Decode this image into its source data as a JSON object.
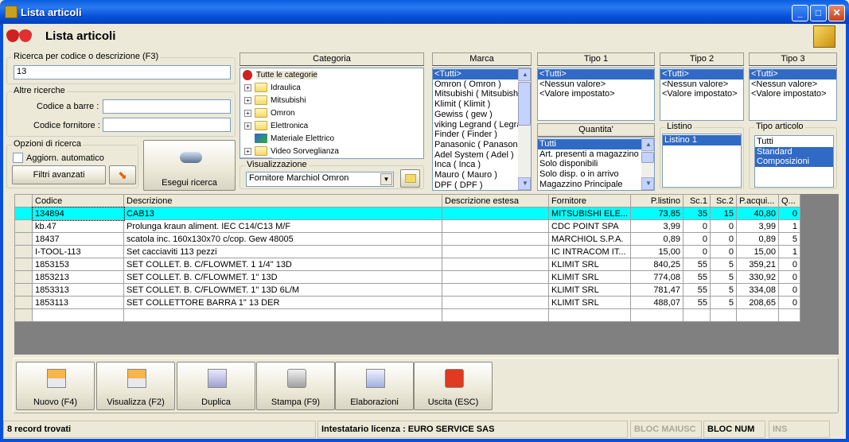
{
  "window": {
    "title": "Lista articoli"
  },
  "header": {
    "title": "Lista articoli"
  },
  "search": {
    "legend": "Ricerca per codice o descrizione (F3)",
    "value": "13"
  },
  "other": {
    "legend": "Altre ricerche",
    "barcode_label": "Codice a barre :",
    "barcode_value": "",
    "supplier_code_label": "Codice fornitore :",
    "supplier_code_value": ""
  },
  "options": {
    "legend": "Opzioni di ricerca",
    "auto_update_label": "Aggiorn. automatico",
    "auto_update_checked": false,
    "advanced_filters": "Filtri avanzati",
    "run_search": "Esegui ricerca"
  },
  "category": {
    "header": "Categoria",
    "items": [
      "Tutte le categorie",
      "Idraulica",
      "Mitsubishi",
      "Omron",
      "Elettronica",
      "Materiale Elettrico",
      "Video Sorveglianza"
    ]
  },
  "view": {
    "legend": "Visualizzazione",
    "selected": "Fornitore Marchiol Omron"
  },
  "brand": {
    "header": "Marca",
    "items": [
      "<Tutti>",
      "Omron ( Omron )",
      "Mitsubishi ( Mitsubishi",
      "Klimit ( Klimit )",
      "Gewiss ( gew )",
      "viking Legrand ( Legra",
      "Finder ( Finder )",
      "Panasonic ( Panasonic",
      "Adel System ( Adel )",
      "Inca ( Inca )",
      "Mauro ( Mauro )",
      "DPF ( DPF )"
    ],
    "selected": 0
  },
  "type1": {
    "header": "Tipo 1",
    "items": [
      "<Tutti>",
      "<Nessun valore>",
      "<Valore impostato>"
    ]
  },
  "type2": {
    "header": "Tipo 2",
    "items": [
      "<Tutti>",
      "<Nessun valore>",
      "<Valore impostato>"
    ]
  },
  "type3": {
    "header": "Tipo 3",
    "items": [
      "<Tutti>",
      "<Nessun valore>",
      "<Valore impostato>"
    ]
  },
  "quantity": {
    "header": "Quantita'",
    "items": [
      "Tutti",
      "Art. presenti a magazzino",
      "Solo disponibili",
      "Solo disp. o in arrivo",
      "Magazzino Principale"
    ]
  },
  "pricelist": {
    "legend": "Listino",
    "items": [
      "Listino 1"
    ]
  },
  "article_type": {
    "legend": "Tipo articolo",
    "items": [
      "Tutti",
      "Standard",
      "Composizioni"
    ]
  },
  "table": {
    "columns": [
      "Codice",
      "Descrizione",
      "Descrizione estesa",
      "Fornitore",
      "P.listino",
      "Sc.1",
      "Sc.2",
      "P.acqui...",
      "Q..."
    ],
    "rows": [
      [
        "134894",
        "CAB13",
        "",
        "MITSUBISHI ELE...",
        "73,85",
        "35",
        "15",
        "40,80",
        "0"
      ],
      [
        "kb.47",
        "Prolunga kraun aliment. IEC C14/C13 M/F",
        "",
        "CDC POINT SPA",
        "3,99",
        "0",
        "0",
        "3,99",
        "1"
      ],
      [
        "18437",
        "scatola inc. 160x130x70 c/cop.   Gew 48005",
        "",
        "MARCHIOL S.P.A.",
        "0,89",
        "0",
        "0",
        "0,89",
        "5"
      ],
      [
        "I-TOOL-113",
        "Set cacciaviti 113 pezzi",
        "",
        "IC INTRACOM IT...",
        "15,00",
        "0",
        "0",
        "15,00",
        "1"
      ],
      [
        "1853153",
        "SET COLLET. B. C/FLOWMET. 1 1/4\" 13D",
        "",
        "KLIMIT SRL",
        "840,25",
        "55",
        "5",
        "359,21",
        "0"
      ],
      [
        "1853213",
        "SET COLLET. B. C/FLOWMET. 1\" 13D",
        "",
        "KLIMIT SRL",
        "774,08",
        "55",
        "5",
        "330,92",
        "0"
      ],
      [
        "1853313",
        "SET COLLET. B. C/FLOWMET. 1\" 13D 6L/M",
        "",
        "KLIMIT SRL",
        "781,47",
        "55",
        "5",
        "334,08",
        "0"
      ],
      [
        "1853113",
        "SET COLLETTORE BARRA 1\" 13 DER",
        "",
        "KLIMIT SRL",
        "488,07",
        "55",
        "5",
        "208,65",
        "0"
      ]
    ]
  },
  "toolbar": [
    {
      "label": "Nuovo (F4)",
      "icon": "new-grid-icon"
    },
    {
      "label": "Visualizza (F2)",
      "icon": "view-grid-icon"
    },
    {
      "label": "Duplica",
      "icon": "duplicate-icon"
    },
    {
      "label": "Stampa (F9)",
      "icon": "printer-icon"
    },
    {
      "label": "Elaborazioni",
      "icon": "process-icon"
    },
    {
      "label": "Uscita (ESC)",
      "icon": "exit-icon"
    }
  ],
  "status": {
    "records": "8 record trovati",
    "license": "Intestatario licenza : EURO SERVICE SAS",
    "caps": "BLOC MAIUSC",
    "num": "BLOC NUM",
    "ins": "INS"
  },
  "colors": {
    "title_bar": "#0a5fe0",
    "selection": "#316ac5",
    "current_row": "#00ffff"
  }
}
